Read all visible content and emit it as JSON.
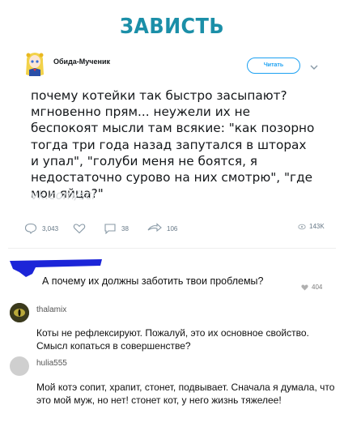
{
  "page": {
    "title": "ЗАВИСТЬ"
  },
  "tweet": {
    "username": "Обида-Мученик",
    "follow_label": "Читать",
    "text": "почему котейки так быстро засыпают? мгновенно прям... неужели их не беспокоят мысли там всякие: \"как позорно тогда три года назад запутался в шторах и упал\", \"голуби меня не боятся, я недостаточно сурово на них смотрю\", \"где мои яйца?\"",
    "watermark": "vk.com/sci",
    "actions": {
      "replies": "3,043",
      "comments": "38",
      "retweets": "106",
      "views": "143K"
    }
  },
  "comments": [
    {
      "username": "",
      "text": "А почему их должны заботить твои проблемы?",
      "likes": "404"
    },
    {
      "username": "thalamix",
      "text": "Коты не рефлексируют. Пожалуй, это их основное свойство. Смысл копаться в совершенстве?"
    },
    {
      "username": "hulia555",
      "text": "Мой котэ сопит, храпит, стонет, подвывает. Сначала я думала, что это мой муж, но нет! стонет кот, у него жизнь тяжелее!"
    }
  ],
  "colors": {
    "title": "#1b8fa8",
    "accent": "#1da1f2",
    "redaction": "#1c25d8"
  },
  "icons": [
    "chevron-down-icon",
    "reply-icon",
    "like-icon",
    "comment-icon",
    "retweet-icon",
    "views-icon",
    "heart-icon"
  ]
}
